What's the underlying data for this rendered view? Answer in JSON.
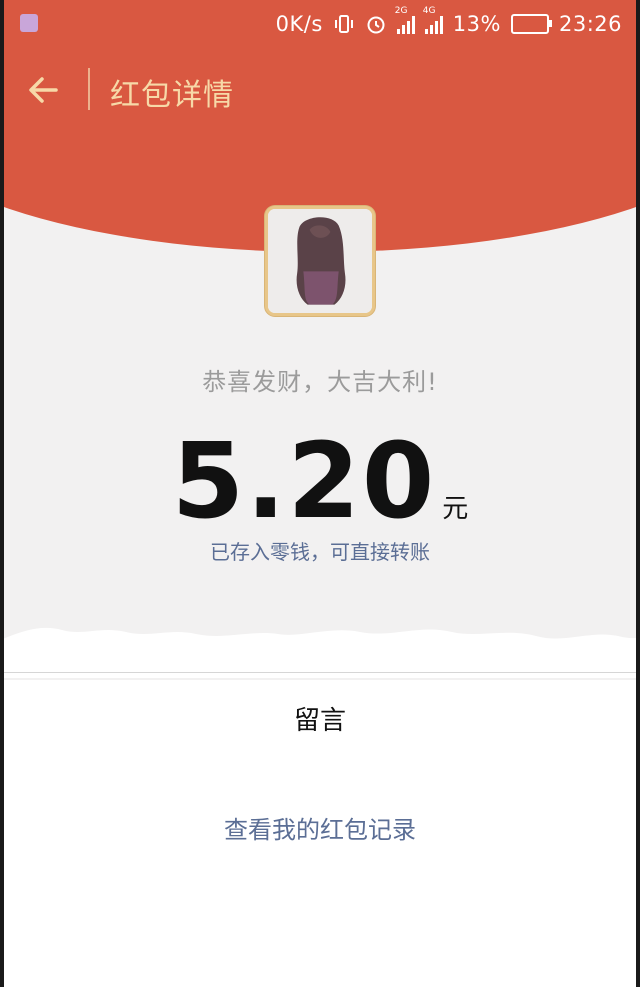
{
  "status_bar": {
    "network_speed": "0K/s",
    "signal_1_tag": "2G",
    "signal_2_tag": "4G",
    "battery_percent": "13%",
    "time": "23:26"
  },
  "header": {
    "title": "红包详情"
  },
  "envelope": {
    "sender_name": "",
    "greeting": "恭喜发财，大吉大利!",
    "amount": "5.20",
    "unit": "元",
    "deposit_note": "已存入零钱，可直接转账"
  },
  "messages": {
    "label": "留言"
  },
  "footer": {
    "records_link": "查看我的红包记录"
  },
  "colors": {
    "header_red": "#d95841",
    "header_text": "#f7d9a8",
    "link_blue": "#5b6e95",
    "background": "#f2f1f1"
  }
}
